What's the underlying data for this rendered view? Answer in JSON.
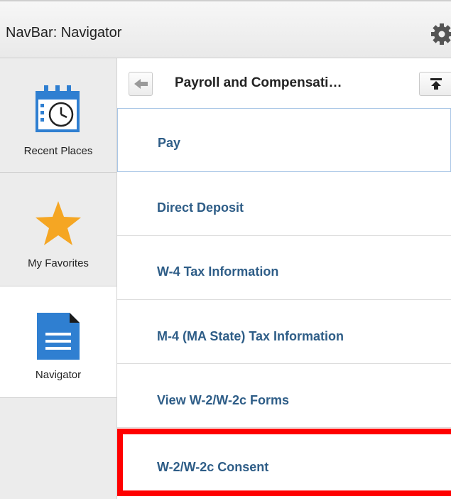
{
  "header": {
    "title": "NavBar: Navigator",
    "settings_icon": "gear-icon"
  },
  "sidebar": {
    "items": [
      {
        "label": "Recent Places",
        "icon": "calendar-clock-icon"
      },
      {
        "label": "My Favorites",
        "icon": "star-icon"
      },
      {
        "label": "Navigator",
        "icon": "document-icon"
      }
    ]
  },
  "content": {
    "title": "Payroll and Compensati…",
    "back_icon": "back-arrow-icon",
    "top_icon": "scroll-top-icon",
    "items": [
      {
        "label": "Pay"
      },
      {
        "label": "Direct Deposit"
      },
      {
        "label": "W-4 Tax Information"
      },
      {
        "label": "M-4 (MA State) Tax Information"
      },
      {
        "label": "View W-2/W-2c Forms"
      },
      {
        "label": "W-2/W-2c Consent"
      }
    ]
  },
  "colors": {
    "link": "#2e5d87",
    "highlight": "#ff0000",
    "star": "#f5a623",
    "doc": "#3b7bd4"
  }
}
